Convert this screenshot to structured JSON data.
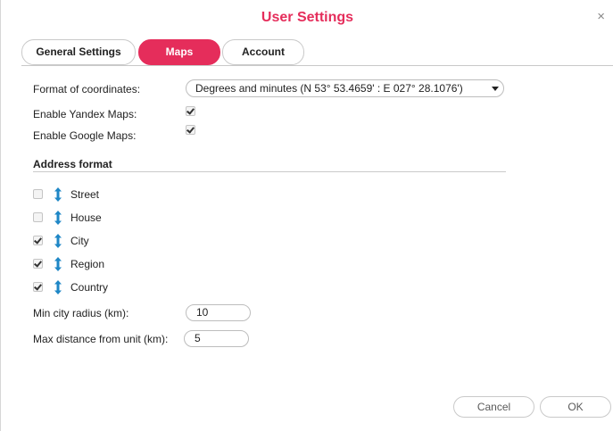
{
  "dialog": {
    "title": "User Settings",
    "close": "×"
  },
  "tabs": [
    {
      "label": "General Settings",
      "active": false
    },
    {
      "label": "Maps",
      "active": true
    },
    {
      "label": "Account",
      "active": false
    }
  ],
  "maps": {
    "coords_label": "Format of coordinates:",
    "coords_value": "Degrees and minutes (N 53° 53.4659' : E 027° 28.1076')",
    "yandex_label": "Enable Yandex Maps:",
    "yandex_checked": true,
    "google_label": "Enable Google Maps:",
    "google_checked": true,
    "address_title": "Address format",
    "address_items": [
      {
        "label": "Street",
        "checked": false
      },
      {
        "label": "House",
        "checked": false
      },
      {
        "label": "City",
        "checked": true
      },
      {
        "label": "Region",
        "checked": true
      },
      {
        "label": "Country",
        "checked": true
      }
    ],
    "min_city_label": "Min city radius (km):",
    "min_city_value": "10",
    "max_dist_label": "Max distance from unit (km):",
    "max_dist_value": "5"
  },
  "buttons": {
    "cancel": "Cancel",
    "ok": "OK"
  },
  "colors": {
    "accent": "#e52d5b",
    "move_icon": "#1f87c6"
  }
}
